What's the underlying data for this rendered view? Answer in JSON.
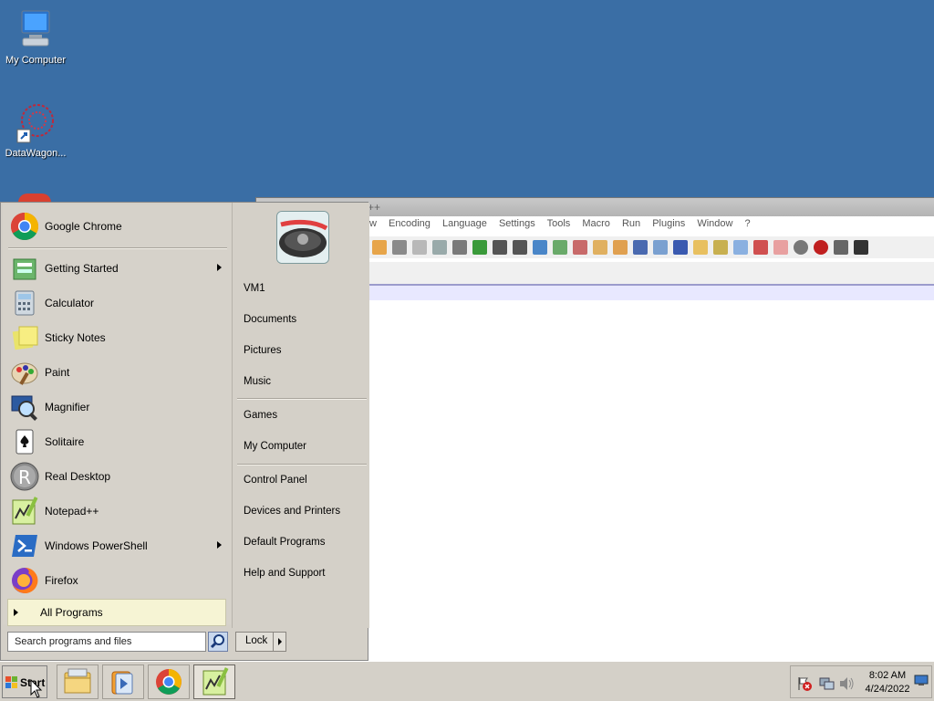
{
  "desktop": {
    "icons": [
      {
        "label": "My Computer",
        "icon": "computer-icon"
      },
      {
        "label": "DataWagon...",
        "icon": "datawagon-icon"
      }
    ]
  },
  "notepad": {
    "title_fragment": "++",
    "menu": [
      "w",
      "Encoding",
      "Language",
      "Settings",
      "Tools",
      "Macro",
      "Run",
      "Plugins",
      "Window",
      "?"
    ]
  },
  "start_menu": {
    "pinned": [
      {
        "label": "Google Chrome",
        "icon": "chrome-icon"
      }
    ],
    "programs": [
      {
        "label": "Getting Started",
        "icon": "getting-started-icon",
        "submenu": true
      },
      {
        "label": "Calculator",
        "icon": "calculator-icon"
      },
      {
        "label": "Sticky Notes",
        "icon": "sticky-notes-icon"
      },
      {
        "label": "Paint",
        "icon": "paint-icon"
      },
      {
        "label": "Magnifier",
        "icon": "magnifier-icon"
      },
      {
        "label": "Solitaire",
        "icon": "solitaire-icon"
      },
      {
        "label": "Real Desktop",
        "icon": "real-desktop-icon"
      },
      {
        "label": "Notepad++",
        "icon": "notepadpp-icon"
      },
      {
        "label": "Windows PowerShell",
        "icon": "powershell-icon",
        "submenu": true
      },
      {
        "label": "Firefox",
        "icon": "firefox-icon"
      }
    ],
    "all_programs": "All Programs",
    "search_placeholder": "Search programs and files",
    "right_links": [
      "VM1",
      "Documents",
      "Pictures",
      "Music",
      "Games",
      "My Computer",
      "Control Panel",
      "Devices and Printers",
      "Default Programs",
      "Help and Support"
    ],
    "lock_label": "Lock"
  },
  "taskbar": {
    "start_label": "Start",
    "pinned": [
      "explorer-icon",
      "media-player-icon",
      "chrome-icon",
      "notepadpp-icon"
    ],
    "tray": {
      "time": "8:02 AM",
      "date": "4/24/2022"
    }
  }
}
